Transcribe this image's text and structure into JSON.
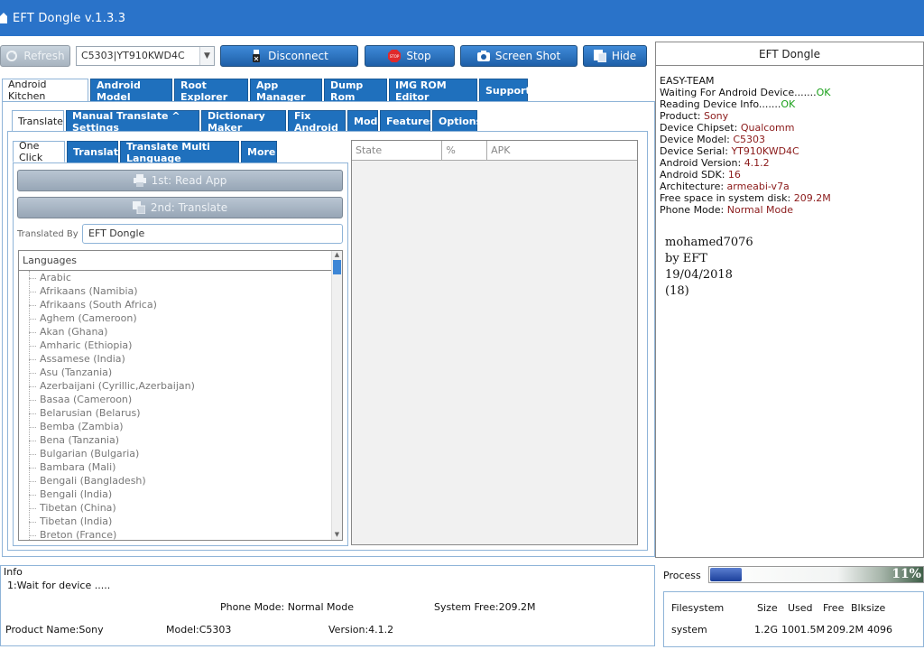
{
  "window": {
    "title": "EFT Dongle  v.1.3.3"
  },
  "toolbar": {
    "refresh": "Refresh",
    "device_selected": "C5303|YT910KWD4C",
    "disconnect": "Disconnect",
    "stop": "Stop",
    "screenshot": "Screen Shot",
    "hide": "Hide"
  },
  "main_tabs": [
    "Android Kitchen",
    "Android Model",
    "Root Explorer",
    "App Manager",
    "Dump Rom",
    "IMG ROM Editor",
    "Support"
  ],
  "sub_tabs": [
    "Translate",
    "Manual Translate ^ Settings",
    "Dictionary Maker",
    "Fix Android",
    "Mod",
    "Features",
    "Options"
  ],
  "inner_tabs": [
    "One Click",
    "Translate",
    "Translate Multi Language",
    "More"
  ],
  "translate": {
    "read_app": "1st: Read App",
    "translate_btn": "2nd: Translate",
    "translated_by_label": "Translated By",
    "translated_by_value": "EFT Dongle",
    "languages_header": "Languages",
    "languages": [
      "Arabic",
      "Afrikaans (Namibia)",
      "Afrikaans (South Africa)",
      "Aghem (Cameroon)",
      "Akan (Ghana)",
      "Amharic (Ethiopia)",
      "Assamese (India)",
      "Asu (Tanzania)",
      "Azerbaijani (Cyrillic,Azerbaijan)",
      "Basaa (Cameroon)",
      "Belarusian (Belarus)",
      "Bemba (Zambia)",
      "Bena (Tanzania)",
      "Bulgarian (Bulgaria)",
      "Bambara (Mali)",
      "Bengali (Bangladesh)",
      "Bengali (India)",
      "Tibetan (China)",
      "Tibetan (India)",
      "Breton (France)"
    ]
  },
  "grid": {
    "columns": [
      "State",
      "%",
      "APK"
    ]
  },
  "log_panel": {
    "title": "EFT Dongle",
    "team": "EASY-TEAM",
    "waiting_label": "Waiting For Android Device.......",
    "waiting_status": "OK",
    "reading_label": "Reading Device Info.......",
    "reading_status": "OK",
    "fields": [
      {
        "label": "Product: ",
        "value": "Sony"
      },
      {
        "label": "Device Chipset: ",
        "value": "Qualcomm"
      },
      {
        "label": "Device Model: ",
        "value": "C5303"
      },
      {
        "label": "Device Serial: ",
        "value": "YT910KWD4C"
      },
      {
        "label": "Android Version: ",
        "value": "4.1.2"
      },
      {
        "label": "Android SDK: ",
        "value": "16"
      },
      {
        "label": "Architecture: ",
        "value": "armeabi-v7a"
      },
      {
        "label": "Free space in system disk: ",
        "value": "209.2M"
      },
      {
        "label": "Phone Mode: ",
        "value": "Normal Mode"
      }
    ],
    "notes": [
      "mohamed7076",
      "by EFT",
      "19/04/2018",
      "(18)"
    ]
  },
  "info": {
    "title": "Info",
    "line1": "1:Wait for device .....",
    "phone_mode": "Phone Mode: Normal Mode",
    "system_free": "System Free:209.2M",
    "product_name": "Product Name:Sony",
    "model": "Model:C5303",
    "version": "Version:4.1.2"
  },
  "process": {
    "label": "Process",
    "percent_text": "11%",
    "fraction": 0.15
  },
  "filesystem": {
    "headers": [
      "Filesystem",
      "Size",
      "Used",
      "Free",
      "Blksize"
    ],
    "row": [
      "system",
      "1.2G",
      "1001.5M",
      "209.2M",
      "4096"
    ]
  },
  "colors": {
    "accent": "#1f70bd",
    "titlebar": "#2a73c9",
    "ok": "#1aa01a",
    "value": "#8b1a1a"
  }
}
